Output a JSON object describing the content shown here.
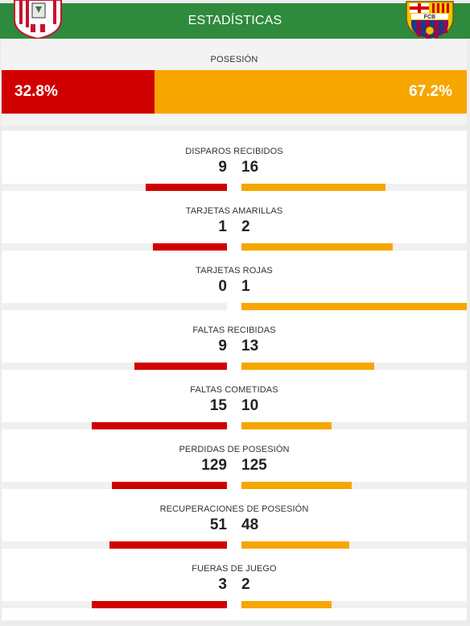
{
  "header": {
    "title": "ESTADÍSTICAS",
    "home_crest_icon": "athletic-club-crest-icon",
    "away_crest_icon": "fc-barcelona-crest-icon",
    "away_crest_letters": "FCB"
  },
  "colors": {
    "home": "#d10000",
    "away": "#f7a600",
    "header": "#2e8a3c"
  },
  "possession": {
    "label": "POSESIÓN",
    "home_display": "32.8%",
    "away_display": "67.2%",
    "home": 32.8,
    "away": 67.2
  },
  "stats": [
    {
      "label": "DISPAROS RECIBIDOS",
      "home": "9",
      "away": "16",
      "home_fill": 0.36,
      "away_fill": 0.64
    },
    {
      "label": "TARJETAS AMARILLAS",
      "home": "1",
      "away": "2",
      "home_fill": 0.33,
      "away_fill": 0.67
    },
    {
      "label": "TARJETAS ROJAS",
      "home": "0",
      "away": "1",
      "home_fill": 0.0,
      "away_fill": 1.0
    },
    {
      "label": "FALTAS RECIBIDAS",
      "home": "9",
      "away": "13",
      "home_fill": 0.41,
      "away_fill": 0.59
    },
    {
      "label": "FALTAS COMETIDAS",
      "home": "15",
      "away": "10",
      "home_fill": 0.6,
      "away_fill": 0.4
    },
    {
      "label": "PERDIDAS DE POSESIÓN",
      "home": "129",
      "away": "125",
      "home_fill": 0.51,
      "away_fill": 0.49
    },
    {
      "label": "RECUPERACIONES DE POSESIÓN",
      "home": "51",
      "away": "48",
      "home_fill": 0.52,
      "away_fill": 0.48
    },
    {
      "label": "FUERAS DE JUEGO",
      "home": "3",
      "away": "2",
      "home_fill": 0.6,
      "away_fill": 0.4
    }
  ]
}
